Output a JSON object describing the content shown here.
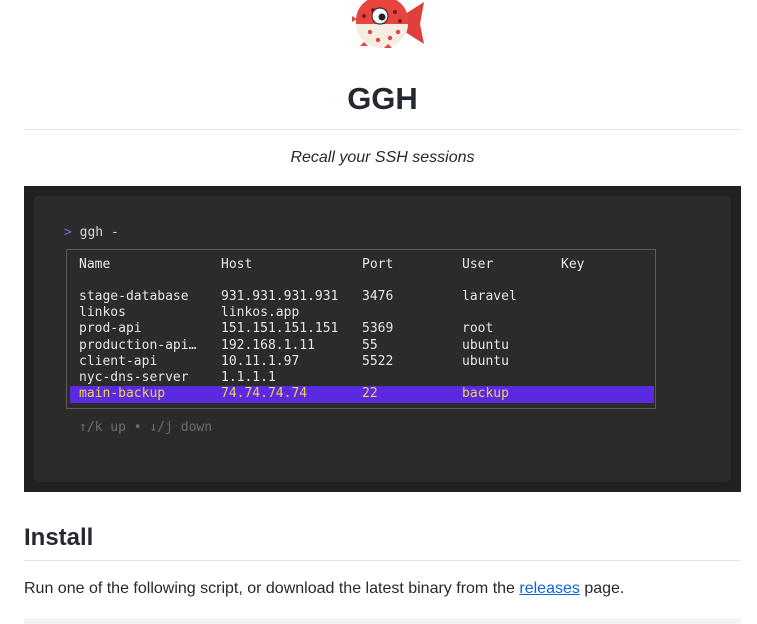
{
  "header": {
    "logo_icon": "pufferfish-logo-icon",
    "title": "GGH",
    "tagline": "Recall your SSH sessions"
  },
  "terminal": {
    "prompt_symbol": ">",
    "command": "ggh -",
    "columns": [
      "Name",
      "Host",
      "Port",
      "User",
      "Key"
    ],
    "rows": [
      {
        "name": "stage-database",
        "host": "931.931.931.931",
        "port": "3476",
        "user": "laravel",
        "key": ""
      },
      {
        "name": "linkos",
        "host": "linkos.app",
        "port": "",
        "user": "",
        "key": ""
      },
      {
        "name": "prod-api",
        "host": "151.151.151.151",
        "port": "5369",
        "user": "root",
        "key": ""
      },
      {
        "name": "production-api…",
        "host": "192.168.1.11",
        "port": "55",
        "user": "ubuntu",
        "key": ""
      },
      {
        "name": "client-api",
        "host": "10.11.1.97",
        "port": "5522",
        "user": "ubuntu",
        "key": ""
      },
      {
        "name": "nyc-dns-server",
        "host": "1.1.1.1",
        "port": "",
        "user": "",
        "key": ""
      },
      {
        "name": "main-backup",
        "host": "74.74.74.74",
        "port": "22",
        "user": "backup",
        "key": ""
      }
    ],
    "selected_row": 6,
    "hint": "↑/k up • ↓/j down",
    "colors": {
      "selection": "#5a2ae0",
      "selected_text": "#f2d44a",
      "background": "#2b2b2b"
    }
  },
  "install": {
    "heading": "Install",
    "text_before": "Run one of the following script, or download the latest binary from the ",
    "link": "releases",
    "text_after": " page."
  }
}
